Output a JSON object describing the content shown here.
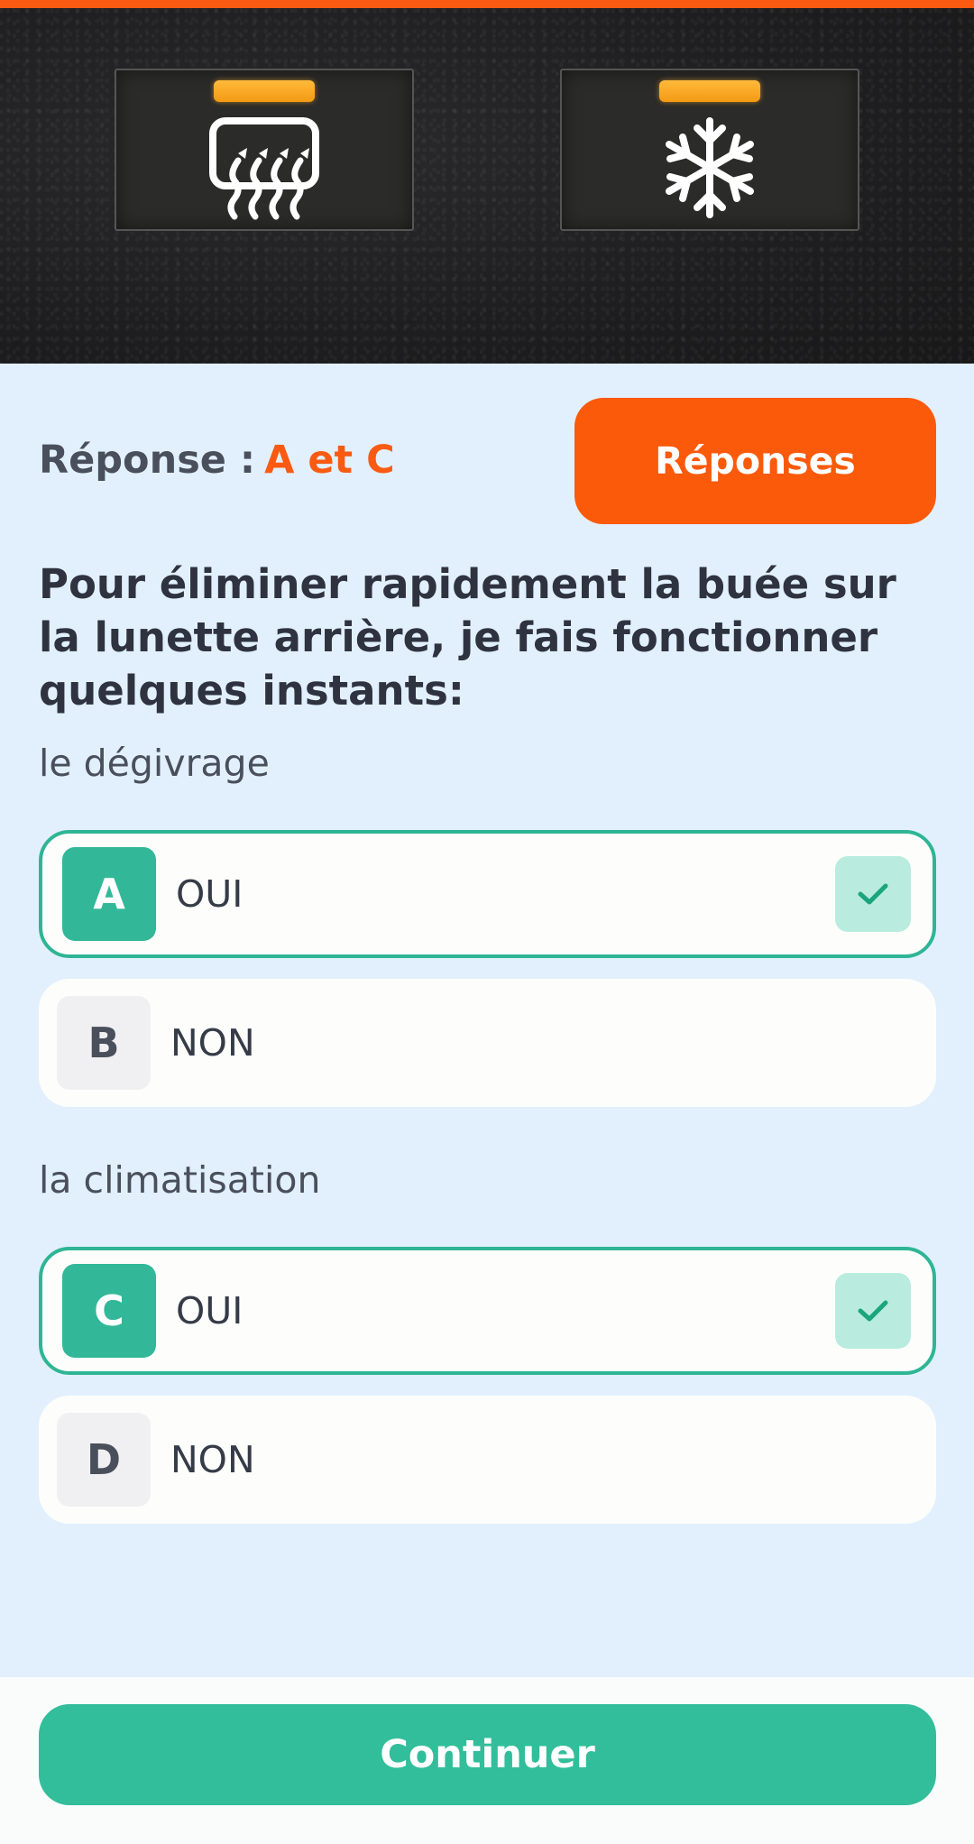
{
  "colors": {
    "accent_orange": "#fa5a12",
    "correct_green": "#32b898",
    "background": "#e2f0fd"
  },
  "hero": {
    "left_icon": "rear-defrost-icon",
    "right_icon": "snowflake-icon"
  },
  "answer": {
    "label": "Réponse :",
    "value": "A et C"
  },
  "reponses_button": "Réponses",
  "question": "Pour éliminer rapidement la buée sur la lunette arrière, je fais fonctionner quelques instants:",
  "groups": [
    {
      "label": "le dégivrage",
      "options": [
        {
          "letter": "A",
          "text": "OUI",
          "correct": true
        },
        {
          "letter": "B",
          "text": "NON",
          "correct": false
        }
      ]
    },
    {
      "label": "la climatisation",
      "options": [
        {
          "letter": "C",
          "text": "OUI",
          "correct": true
        },
        {
          "letter": "D",
          "text": "NON",
          "correct": false
        }
      ]
    }
  ],
  "continue_button": "Continuer"
}
